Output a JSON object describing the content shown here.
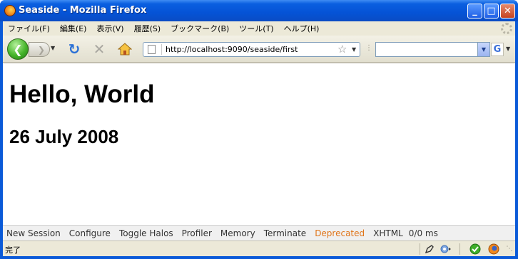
{
  "window": {
    "title": "Seaside - Mozilla Firefox",
    "controls": {
      "minimize": "_",
      "maximize": "□",
      "close": "✕"
    }
  },
  "menubar": {
    "items": [
      "ファイル(F)",
      "編集(E)",
      "表示(V)",
      "履歴(S)",
      "ブックマーク(B)",
      "ツール(T)",
      "ヘルプ(H)"
    ]
  },
  "navbar": {
    "back_icon": "back-arrow-icon",
    "forward_icon": "forward-arrow-icon",
    "url": "http://localhost:9090/seaside/first",
    "search_value": ""
  },
  "content": {
    "heading1": "Hello, World",
    "heading2": "26 July 2008"
  },
  "seaside_toolbar": {
    "links": [
      {
        "label": "New Session"
      },
      {
        "label": "Configure"
      },
      {
        "label": "Toggle Halos"
      },
      {
        "label": "Profiler"
      },
      {
        "label": "Memory"
      },
      {
        "label": "Terminate"
      },
      {
        "label": "Deprecated"
      }
    ],
    "xhtml": "XHTML",
    "timing": "0/0 ms"
  },
  "statusbar": {
    "text": "完了"
  },
  "colors": {
    "deprecated_link": "#e0751a",
    "titlebar": "#0553d6"
  }
}
